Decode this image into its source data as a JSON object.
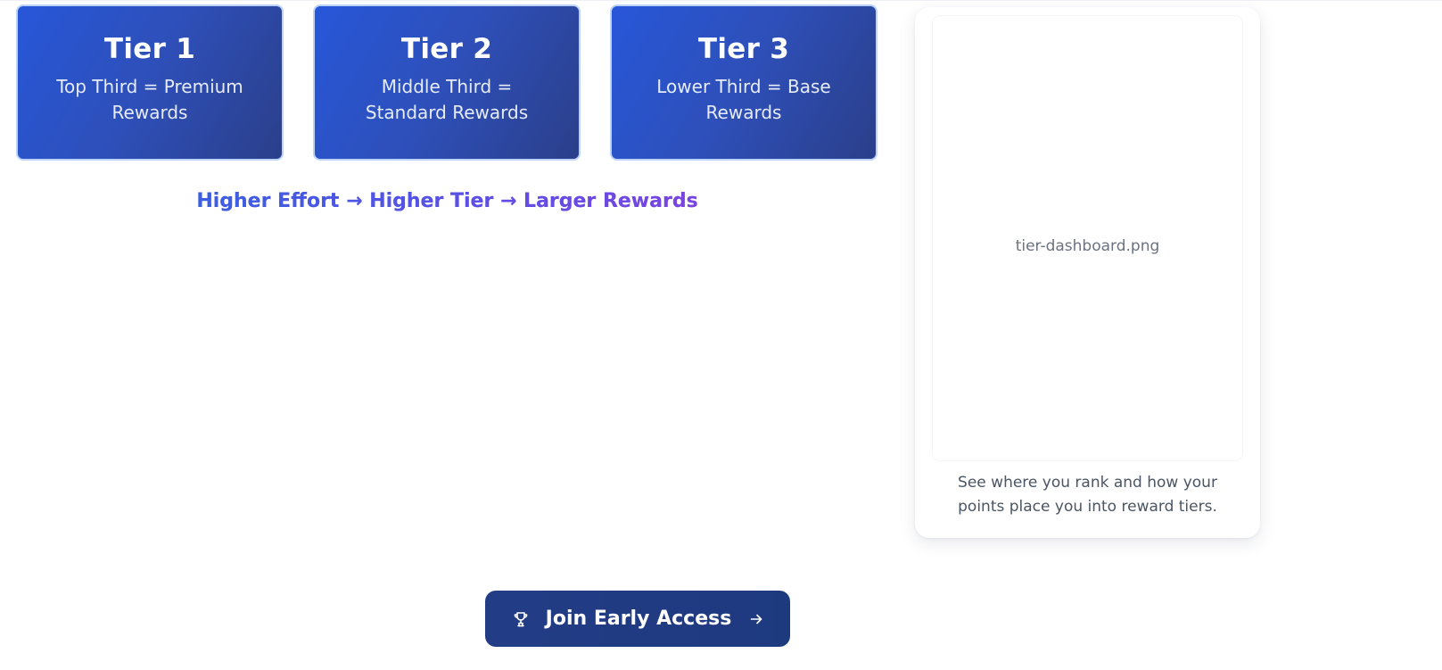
{
  "tiers": [
    {
      "title": "Tier 1",
      "description": "Top Third = Premium Rewards"
    },
    {
      "title": "Tier 2",
      "description": "Middle Third = Standard Rewards"
    },
    {
      "title": "Tier 3",
      "description": "Lower Third = Base Rewards"
    }
  ],
  "effort_line": "Higher Effort → Higher Tier → Larger Rewards",
  "dashboard": {
    "image_filename": "tier-dashboard.png",
    "caption": "See where you rank and how your points place you into reward tiers."
  },
  "cta": {
    "label": "Join Early Access",
    "icon": "trophy-icon",
    "trailing_icon": "arrow-right-icon"
  },
  "colors": {
    "tier_card_start": "#2757d9",
    "tier_card_end": "#2b3f8a",
    "effort_gradient_start": "#3b5fe0",
    "effort_gradient_end": "#7b44df",
    "cta_background": "#1e3a7f"
  }
}
